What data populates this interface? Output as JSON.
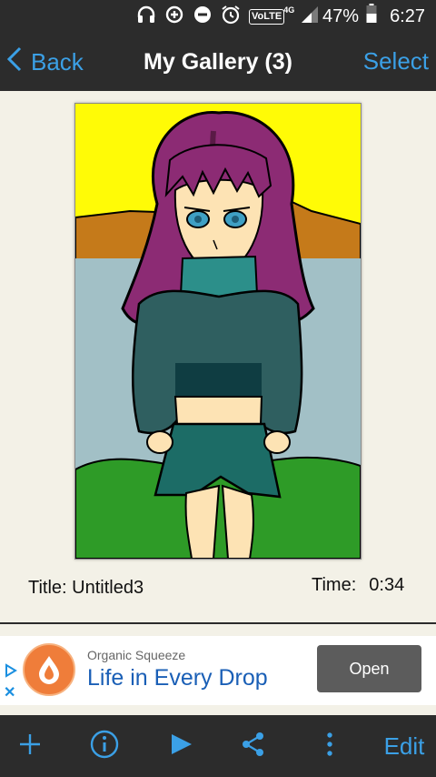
{
  "status_bar": {
    "battery_percent": "47%",
    "time": "6:27",
    "network_label": "VoLTE",
    "network_type": "4G",
    "icons": [
      "headphones-icon",
      "data-saver-icon",
      "do-not-disturb-icon",
      "alarm-icon",
      "signal-icon",
      "battery-icon"
    ]
  },
  "nav": {
    "back_label": "Back",
    "title": "My Gallery (3)",
    "select_label": "Select"
  },
  "artwork": {
    "title_text": "Title: Untitled3",
    "time_label": "Time:",
    "time_value": "0:34"
  },
  "ad": {
    "brand": "Organic Squeeze",
    "headline": "Life in Every Drop",
    "button_label": "Open",
    "logo_text": "ORGANIC SQUEEZE"
  },
  "toolbar": {
    "edit_label": "Edit",
    "icons": [
      "add-icon",
      "info-icon",
      "play-icon",
      "share-icon",
      "more-icon"
    ]
  },
  "colors": {
    "accent": "#3ba0e6",
    "bar_background": "#2c2c2c",
    "page_background": "#f3f1e7",
    "ad_button": "#5c5c5c",
    "ad_headline": "#1a5fb6"
  }
}
